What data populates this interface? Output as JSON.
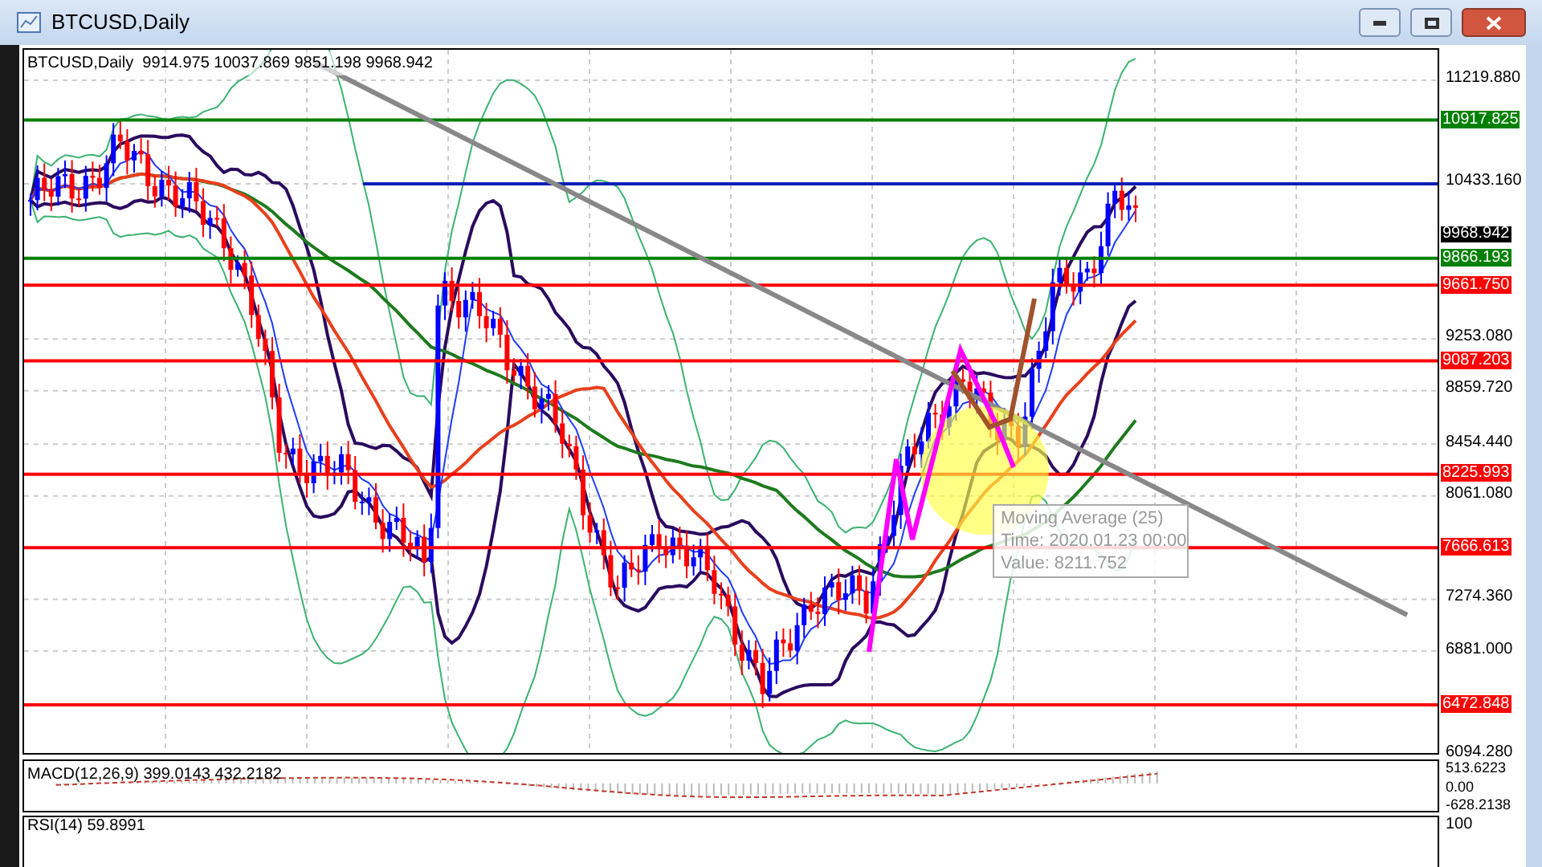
{
  "window": {
    "title": "BTCUSD,Daily"
  },
  "chart": {
    "header": "BTCUSD,Daily  9914.975 10037.869 9851.198 9968.942",
    "ticks": [
      "11219.880",
      "10433.160",
      "9253.080",
      "8859.720",
      "8454.440",
      "8061.080",
      "7274.360",
      "6881.000",
      "6094.280"
    ],
    "levels": [
      {
        "label": "10917.825",
        "color": "#008000"
      },
      {
        "label": "9866.193",
        "color": "#008000"
      },
      {
        "label": "9661.750",
        "color": "#ff0000"
      },
      {
        "label": "9087.203",
        "color": "#ff0000"
      },
      {
        "label": "8225.993",
        "color": "#ff0000"
      },
      {
        "label": "7666.613",
        "color": "#ff0000"
      },
      {
        "label": "6472.848",
        "color": "#ff0000"
      }
    ],
    "current_price": "9968.942",
    "tooltip": [
      "Moving Average (25)",
      "Time: 2020.01.23 00:00",
      "Value: 8211.752"
    ]
  },
  "macd": {
    "header": "MACD(12,26,9) 399.0143 432.2182",
    "ticks": [
      "513.6223",
      "0.00",
      "-628.2138"
    ]
  },
  "rsi": {
    "header": "RSI(14) 59.8991",
    "ticks": [
      "100"
    ]
  }
}
